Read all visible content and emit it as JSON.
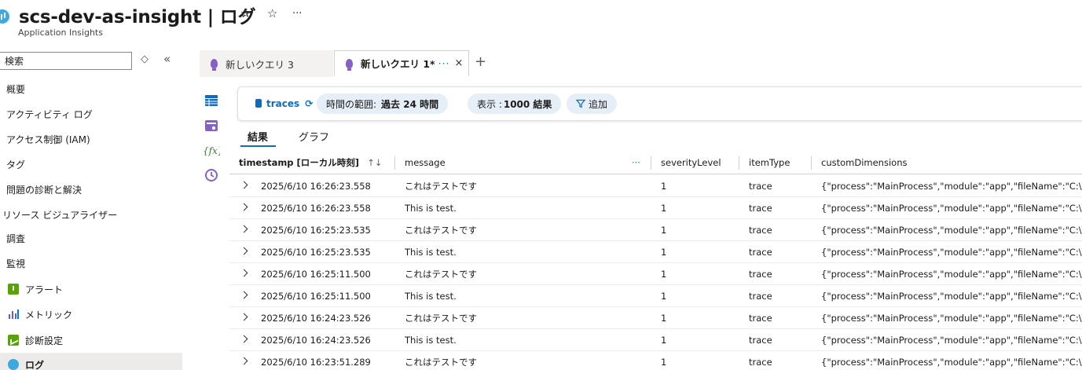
{
  "header": {
    "title": "scs-dev-as-insight | ログ",
    "subtitle": "Application Insights",
    "pin_glyph": "✰",
    "star_glyph": "☆",
    "more_glyph": "···"
  },
  "sidebar": {
    "search_placeholder": "検索",
    "options_glyph": "◇",
    "collapse_glyph": "«",
    "items": [
      {
        "label": "概要"
      },
      {
        "label": "アクティビティ ログ"
      },
      {
        "label": "アクセス制御 (IAM)"
      },
      {
        "label": "タグ"
      },
      {
        "label": "問題の診断と解決"
      },
      {
        "label": "リソース ビジュアライザー"
      },
      {
        "label": "調査"
      },
      {
        "label": "監視"
      },
      {
        "label": "アラート",
        "icon": "alert-icon"
      },
      {
        "label": "メトリック",
        "icon": "metrics-icon"
      },
      {
        "label": "診断設定",
        "icon": "diagnostic-settings-icon"
      },
      {
        "label": "ログ",
        "icon": "logs-icon"
      }
    ]
  },
  "tabs": [
    {
      "label": "新しいクエリ 3",
      "active": false
    },
    {
      "label": "新しいクエリ 1*",
      "active": true,
      "more": "···",
      "close": "×"
    }
  ],
  "tab_add": "+",
  "query_toolbar": {
    "table": "traces",
    "refresh_glyph": "⟳",
    "time_range_label": "時間の範囲:",
    "time_range_value": "過去 24 時間",
    "show_label": "表示 :",
    "show_value": "1000 結果",
    "add_label": "追加"
  },
  "result_tabs": [
    {
      "label": "結果",
      "active": true
    },
    {
      "label": "グラフ",
      "active": false
    }
  ],
  "grid": {
    "columns": [
      {
        "label": "timestamp [ローカル時刻]",
        "sort": "↑↓"
      },
      {
        "label": "message",
        "more": "···"
      },
      {
        "label": "severityLevel"
      },
      {
        "label": "itemType"
      },
      {
        "label": "customDimensions"
      }
    ],
    "rows": [
      {
        "timestamp": "2025/6/10 16:26:23.558",
        "message": "これはテストです",
        "severityLevel": "1",
        "itemType": "trace",
        "customDimensions": "{\"process\":\"MainProcess\",\"module\":\"app\",\"fileName\":\"C:\\\\te..."
      },
      {
        "timestamp": "2025/6/10 16:26:23.558",
        "message": "This is test.",
        "severityLevel": "1",
        "itemType": "trace",
        "customDimensions": "{\"process\":\"MainProcess\",\"module\":\"app\",\"fileName\":\"C:\\\\te..."
      },
      {
        "timestamp": "2025/6/10 16:25:23.535",
        "message": "これはテストです",
        "severityLevel": "1",
        "itemType": "trace",
        "customDimensions": "{\"process\":\"MainProcess\",\"module\":\"app\",\"fileName\":\"C:\\\\te..."
      },
      {
        "timestamp": "2025/6/10 16:25:23.535",
        "message": "This is test.",
        "severityLevel": "1",
        "itemType": "trace",
        "customDimensions": "{\"process\":\"MainProcess\",\"module\":\"app\",\"fileName\":\"C:\\\\te..."
      },
      {
        "timestamp": "2025/6/10 16:25:11.500",
        "message": "これはテストです",
        "severityLevel": "1",
        "itemType": "trace",
        "customDimensions": "{\"process\":\"MainProcess\",\"module\":\"app\",\"fileName\":\"C:\\\\te..."
      },
      {
        "timestamp": "2025/6/10 16:25:11.500",
        "message": "This is test.",
        "severityLevel": "1",
        "itemType": "trace",
        "customDimensions": "{\"process\":\"MainProcess\",\"module\":\"app\",\"fileName\":\"C:\\\\te..."
      },
      {
        "timestamp": "2025/6/10 16:24:23.526",
        "message": "これはテストです",
        "severityLevel": "1",
        "itemType": "trace",
        "customDimensions": "{\"process\":\"MainProcess\",\"module\":\"app\",\"fileName\":\"C:\\\\te..."
      },
      {
        "timestamp": "2025/6/10 16:24:23.526",
        "message": "This is test.",
        "severityLevel": "1",
        "itemType": "trace",
        "customDimensions": "{\"process\":\"MainProcess\",\"module\":\"app\",\"fileName\":\"C:\\\\te..."
      },
      {
        "timestamp": "2025/6/10 16:23:51.289",
        "message": "これはテストです",
        "severityLevel": "1",
        "itemType": "trace",
        "customDimensions": "{\"process\":\"MainProcess\",\"module\":\"app\",\"fileName\":\"C:\\\\te..."
      }
    ]
  }
}
